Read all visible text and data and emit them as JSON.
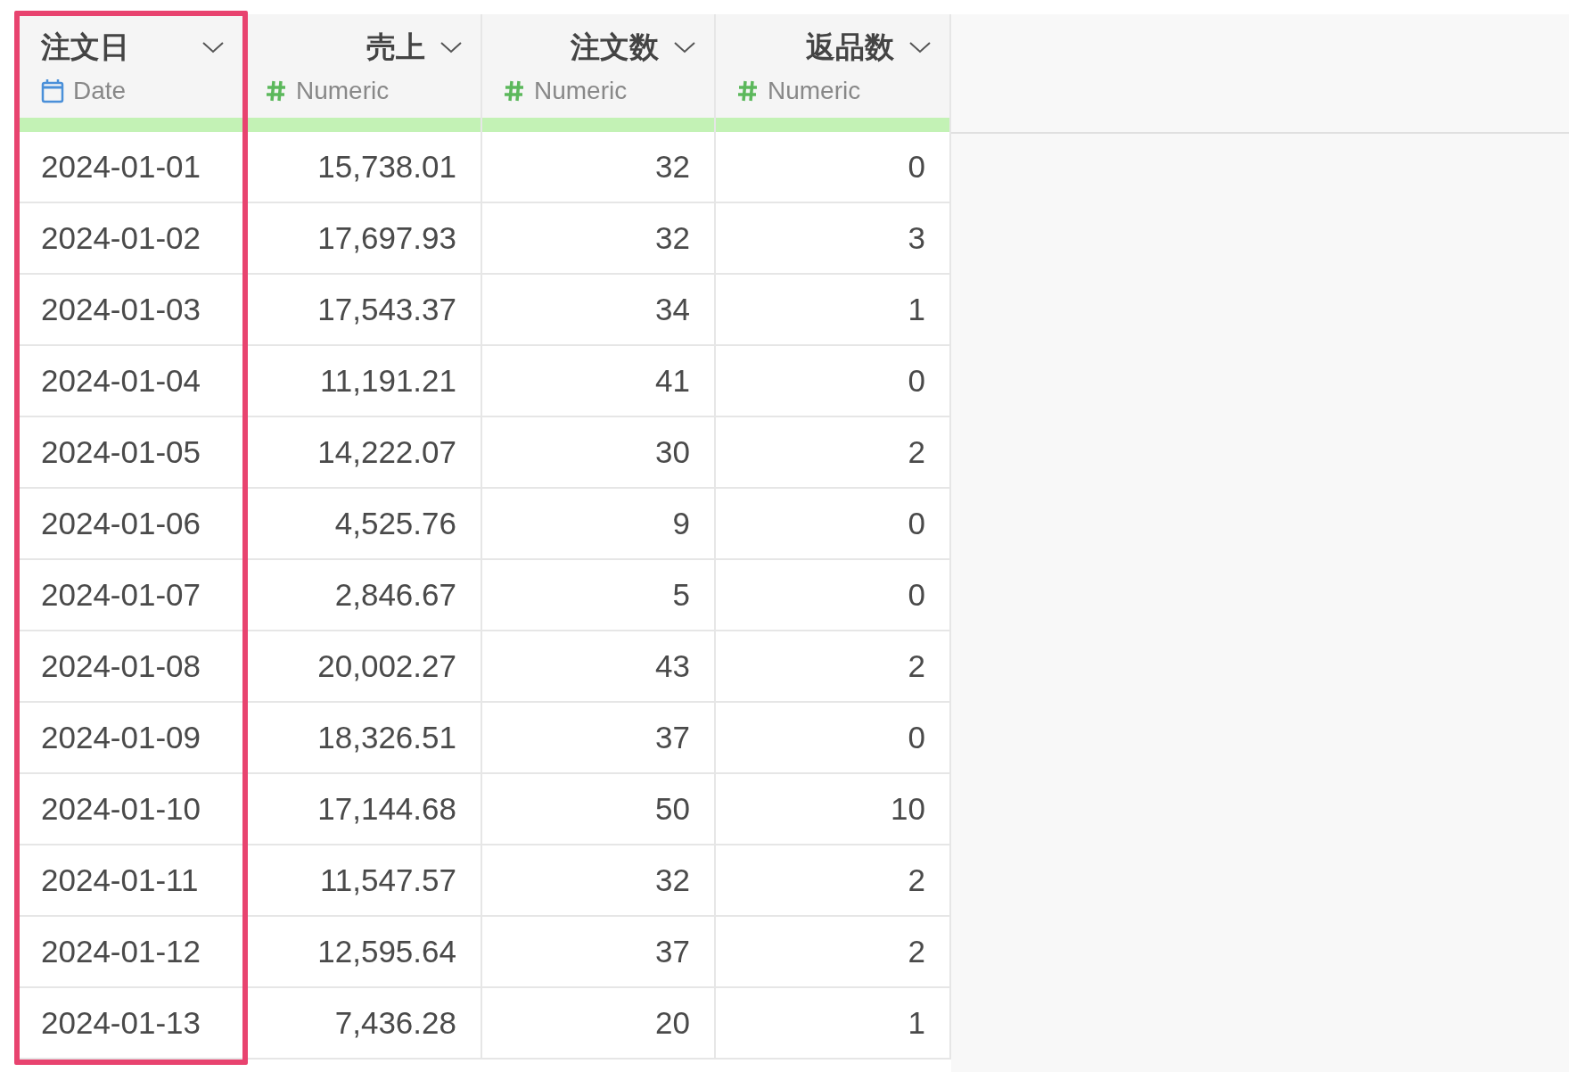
{
  "table": {
    "columns": [
      {
        "title": "注文日",
        "kind": "date",
        "type_label": "Date",
        "highlighted": true
      },
      {
        "title": "売上",
        "kind": "numeric",
        "type_label": "Numeric",
        "highlighted": false
      },
      {
        "title": "注文数",
        "kind": "numeric",
        "type_label": "Numeric",
        "highlighted": false
      },
      {
        "title": "返品数",
        "kind": "numeric",
        "type_label": "Numeric",
        "highlighted": false
      }
    ],
    "rows": [
      [
        "2024-01-01",
        "15,738.01",
        "32",
        "0"
      ],
      [
        "2024-01-02",
        "17,697.93",
        "32",
        "3"
      ],
      [
        "2024-01-03",
        "17,543.37",
        "34",
        "1"
      ],
      [
        "2024-01-04",
        "11,191.21",
        "41",
        "0"
      ],
      [
        "2024-01-05",
        "14,222.07",
        "30",
        "2"
      ],
      [
        "2024-01-06",
        "4,525.76",
        "9",
        "0"
      ],
      [
        "2024-01-07",
        "2,846.67",
        "5",
        "0"
      ],
      [
        "2024-01-08",
        "20,002.27",
        "43",
        "2"
      ],
      [
        "2024-01-09",
        "18,326.51",
        "37",
        "0"
      ],
      [
        "2024-01-10",
        "17,144.68",
        "50",
        "10"
      ],
      [
        "2024-01-11",
        "11,547.57",
        "32",
        "2"
      ],
      [
        "2024-01-12",
        "12,595.64",
        "37",
        "2"
      ],
      [
        "2024-01-13",
        "7,436.28",
        "20",
        "1"
      ]
    ]
  }
}
